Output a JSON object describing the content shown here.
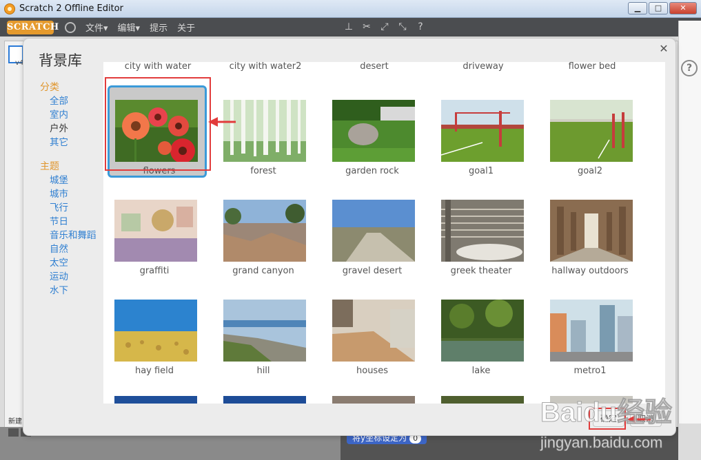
{
  "window": {
    "title": "Scratch 2 Offline Editor",
    "btn_min": "▁",
    "btn_max": "□",
    "btn_close": "✕"
  },
  "menubar": {
    "logo": "SCRATCH",
    "file": "文件▾",
    "edit": "编辑▾",
    "tips": "提示",
    "about": "关于"
  },
  "left": {
    "new_label": "新建",
    "version_label": "v4"
  },
  "block_chip": {
    "text": "将y坐标设定为",
    "value": "0"
  },
  "modal": {
    "title": "背景库",
    "close": "✕",
    "category_heading": "分类",
    "categories": [
      "全部",
      "室内",
      "户外",
      "其它"
    ],
    "selected_category": "户外",
    "theme_heading": "主题",
    "themes": [
      "城堡",
      "城市",
      "飞行",
      "节日",
      "音乐和舞蹈",
      "自然",
      "太空",
      "运动",
      "水下"
    ],
    "top_row_labels": [
      "city with water",
      "city with water2",
      "desert",
      "driveway",
      "flower bed"
    ],
    "rows": [
      [
        "flowers",
        "forest",
        "garden rock",
        "goal1",
        "goal2"
      ],
      [
        "graffiti",
        "grand canyon",
        "gravel desert",
        "greek theater",
        "hallway outdoors"
      ],
      [
        "hay field",
        "hill",
        "houses",
        "lake",
        "metro1"
      ]
    ],
    "selected_item": "flowers",
    "ok_label": "确定",
    "cancel_label": "取消"
  },
  "watermark": {
    "line1": "Baidu经验",
    "line2": "jingyan.baidu.com"
  },
  "colors": {
    "accent_orange": "#e0962e",
    "link_blue": "#2f7fd1",
    "selection_blue": "#3a9ad9",
    "annotation_red": "#e23b3b"
  }
}
